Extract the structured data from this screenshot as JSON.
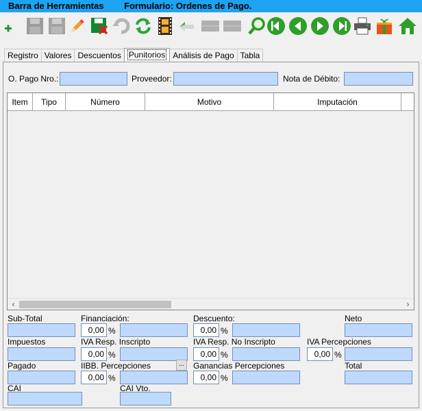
{
  "titlebar": {
    "toolbar_title": "Barra de Herramientas",
    "form_title": "Formulario: Ordenes de Pago."
  },
  "toolbar": {
    "buttons": [
      {
        "icon": "add-icon"
      },
      {
        "icon": "save-icon"
      },
      {
        "icon": "save-as-icon"
      },
      {
        "icon": "edit-icon"
      },
      {
        "icon": "save-cancel-icon"
      },
      {
        "icon": "undo-icon"
      },
      {
        "icon": "refresh-icon"
      },
      {
        "icon": "film-icon"
      },
      {
        "icon": "back-arrow-icon"
      },
      {
        "icon": "grid-icon"
      },
      {
        "icon": "grid-icon"
      },
      {
        "icon": "search-icon"
      },
      {
        "icon": "first-record-icon"
      },
      {
        "icon": "previous-record-icon"
      },
      {
        "icon": "next-record-icon"
      },
      {
        "icon": "last-record-icon"
      },
      {
        "icon": "print-icon"
      },
      {
        "icon": "gift-icon"
      },
      {
        "icon": "home-icon"
      }
    ]
  },
  "tabs": [
    "Registro",
    "Valores",
    "Descuentos",
    "Punitorios",
    "Análisis de Pago",
    "Tabla"
  ],
  "active_tab": "Punitorios",
  "header_fields": {
    "pago_label": "O. Pago Nro.:",
    "proveedor_label": "Proveedor:",
    "nota_label": "Nota de Débito:"
  },
  "grid": {
    "columns": [
      "Item",
      "Tipo",
      "Número",
      "Motivo",
      "Imputación"
    ]
  },
  "totals": {
    "subtotal_label": "Sub-Total",
    "financiacion_label": "Financiación:",
    "financiacion_pct": "0,00",
    "descuento_label": "Descuento:",
    "descuento_pct": "0,00",
    "neto_label": "Neto",
    "impuestos_label": "Impuestos",
    "iva_ri_label": "IVA Resp. Inscripto",
    "iva_ri_pct": "0,00",
    "iva_rni_label": "IVA Resp. No Inscripto",
    "iva_rni_pct": "0,00",
    "iva_perc_label": "IVA Percepciones",
    "iva_perc_pct": "0,00",
    "pagado_label": "Pagado",
    "iibb_label": "IIBB. Percepciones",
    "iibb_pct": "0,00",
    "ganancias_label": "Ganancias Percepciones",
    "ganancias_pct": "0,00",
    "total_label": "Total",
    "cai_label": "CAI",
    "cai_vto_label": "CAI Vto.",
    "pct_symbol": "%",
    "ellipsis": "..."
  }
}
